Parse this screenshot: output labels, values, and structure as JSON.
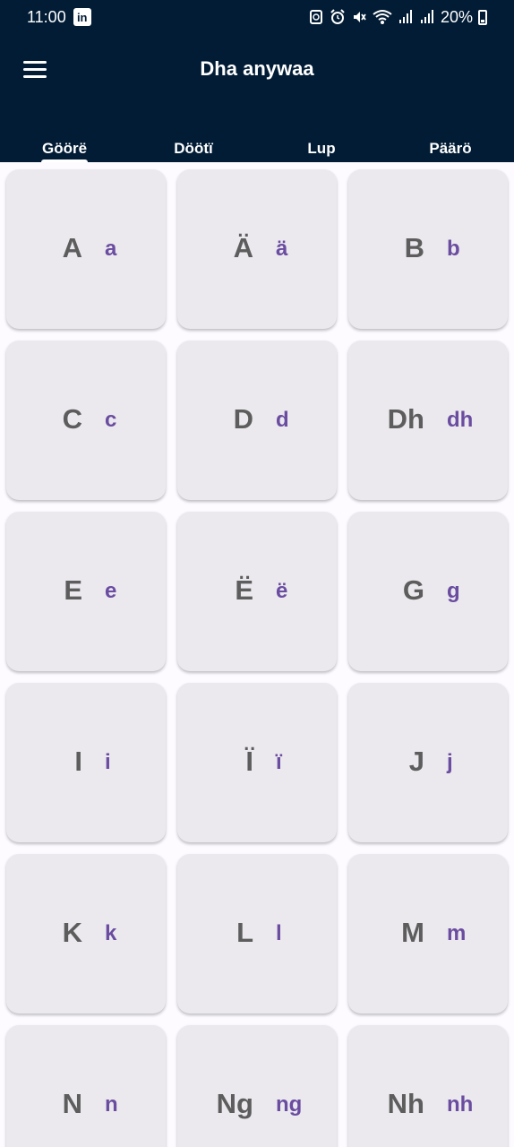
{
  "status": {
    "time": "11:00",
    "notification_icon": "linkedin-icon",
    "battery": "20%",
    "battery_level": 0.2
  },
  "header": {
    "title": "Dha anywaa"
  },
  "tabs": [
    {
      "label": "Göörë",
      "active": true
    },
    {
      "label": "Döötï",
      "active": false
    },
    {
      "label": "Lup",
      "active": false
    },
    {
      "label": "Päärö",
      "active": false
    }
  ],
  "letters": [
    {
      "upper": "A",
      "lower": "a"
    },
    {
      "upper": "Ä",
      "lower": "ä"
    },
    {
      "upper": "B",
      "lower": "b"
    },
    {
      "upper": "C",
      "lower": "c"
    },
    {
      "upper": "D",
      "lower": "d"
    },
    {
      "upper": "Dh",
      "lower": "dh"
    },
    {
      "upper": "E",
      "lower": "e"
    },
    {
      "upper": "Ë",
      "lower": "ë"
    },
    {
      "upper": "G",
      "lower": "g"
    },
    {
      "upper": "I",
      "lower": "i"
    },
    {
      "upper": "Ï",
      "lower": "ï"
    },
    {
      "upper": "J",
      "lower": "j"
    },
    {
      "upper": "K",
      "lower": "k"
    },
    {
      "upper": "L",
      "lower": "l"
    },
    {
      "upper": "M",
      "lower": "m"
    },
    {
      "upper": "N",
      "lower": "n"
    },
    {
      "upper": "Ng",
      "lower": "ng"
    },
    {
      "upper": "Nh",
      "lower": "nh"
    }
  ],
  "colors": {
    "appbar": "#021c35",
    "card": "#ebe9ee",
    "upper_text": "#5d5d5d",
    "lower_text": "#6a4ca0"
  }
}
